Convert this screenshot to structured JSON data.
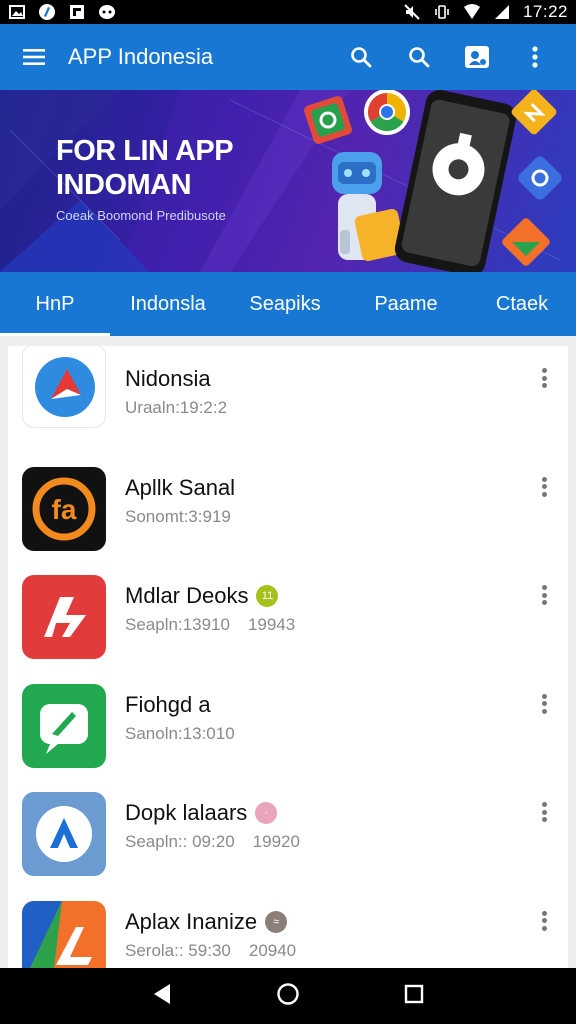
{
  "status_bar": {
    "time": "17:22",
    "left_icons": [
      "gallery-icon",
      "app-icon",
      "flipboard-icon",
      "chat-icon"
    ],
    "right_icons": [
      "mute-icon",
      "vibrate-icon",
      "wifi-icon",
      "signal-icon"
    ]
  },
  "app_bar": {
    "title": "APP Indonesia",
    "icons": [
      "menu-icon",
      "search-icon",
      "search-icon",
      "account-icon",
      "more-vert-icon"
    ]
  },
  "banner": {
    "headline_1": "FOR LIN APP",
    "headline_2": "INDOMAN",
    "subtitle": "Coeak Boomond Predibusote"
  },
  "tabs": [
    {
      "label": "HnP",
      "active": true
    },
    {
      "label": "Indonsla",
      "active": false
    },
    {
      "label": "Seapiks",
      "active": false
    },
    {
      "label": "Paame",
      "active": false
    },
    {
      "label": "Ctaek",
      "active": false
    }
  ],
  "apps": [
    {
      "name": "Nidonsia",
      "meta_1": "Uraaln:19:2:2",
      "meta_2": "",
      "badge": "",
      "badge_color": ""
    },
    {
      "name": "Apllk Sanal",
      "meta_1": "Sonomt:3:919",
      "meta_2": "",
      "badge": "",
      "badge_color": ""
    },
    {
      "name": "Mdlar Deoks",
      "meta_1": "Seapln:13910",
      "meta_2": "19943",
      "badge": "11",
      "badge_color": "#a4c21c"
    },
    {
      "name": "Fiohgd a",
      "meta_1": "Sanoln:13:010",
      "meta_2": "",
      "badge": "",
      "badge_color": ""
    },
    {
      "name": "Dopk lalaars",
      "meta_1": "Seapln:: 09:20",
      "meta_2": "19920",
      "badge": "·",
      "badge_color": "#e8a5bc"
    },
    {
      "name": "Aplax Inanize",
      "meta_1": "Serola:: 59:30",
      "meta_2": "20940",
      "badge": "≈",
      "badge_color": "#8c7f7a"
    }
  ],
  "colors": {
    "primary": "#1877d2",
    "banner_gradient": "#3a1fa8"
  }
}
